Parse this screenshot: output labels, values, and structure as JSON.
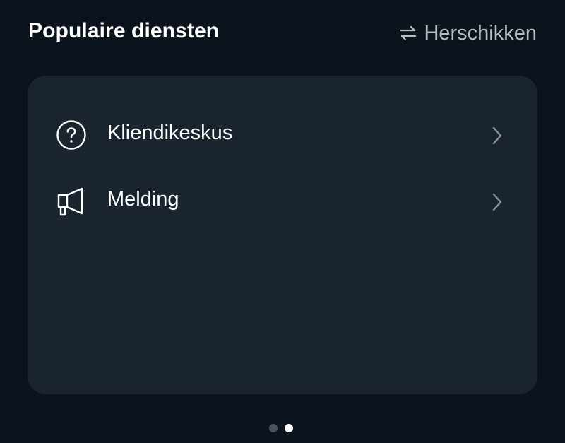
{
  "header": {
    "title": "Populaire diensten",
    "reorder_label": "Herschikken",
    "reorder_icon": "swap-arrows-icon"
  },
  "services": [
    {
      "label": "Kliendikeskus",
      "icon": "question-circle-icon",
      "chevron": "chevron-right-icon"
    },
    {
      "label": "Melding",
      "icon": "megaphone-icon",
      "chevron": "chevron-right-icon"
    }
  ],
  "pager": {
    "total_pages": 2,
    "current_page": 2
  },
  "colors": {
    "background": "#0b141c",
    "card": "#1a242e",
    "text_primary": "#ffffff",
    "text_secondary": "#b6bcc3",
    "chevron": "#8a939b",
    "dot_inactive": "#4a535c",
    "dot_active": "#ffffff"
  }
}
